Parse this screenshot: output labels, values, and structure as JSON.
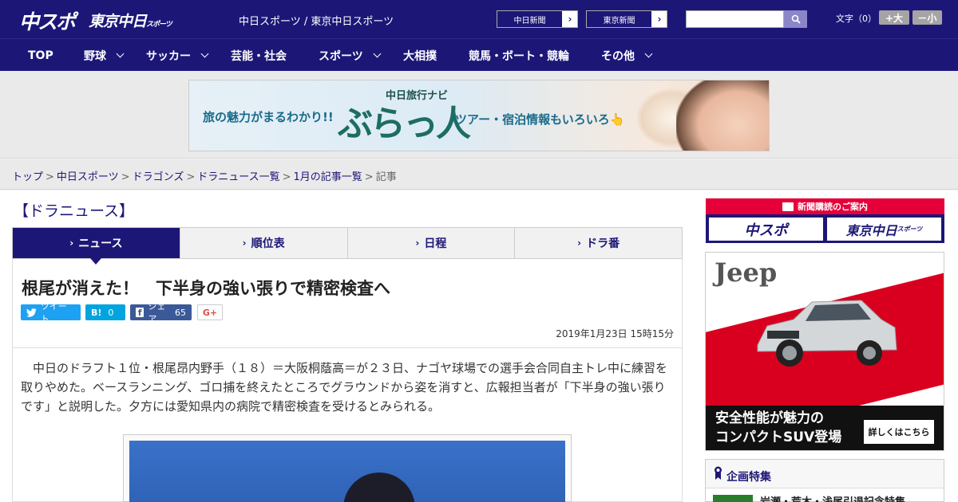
{
  "header": {
    "logo_chuspo": "中スポ",
    "logo_tokyo": "東京中日",
    "logo_tokyo_small": "スポーツ",
    "site_links": "中日スポーツ / 東京中日スポーツ",
    "ext_links": [
      {
        "label": "中日新聞",
        "arrow": "›"
      },
      {
        "label": "東京新聞",
        "arrow": "›"
      }
    ],
    "search_placeholder": "",
    "search_icon": "search-icon",
    "font_size_label": "文字（0）",
    "font_up": "+大",
    "font_down": "－小"
  },
  "nav": {
    "items": [
      {
        "label": "TOP",
        "dropdown": false
      },
      {
        "label": "野球",
        "dropdown": true
      },
      {
        "label": "サッカー",
        "dropdown": true
      },
      {
        "label": "芸能・社会",
        "dropdown": false
      },
      {
        "label": "スポーツ",
        "dropdown": true
      },
      {
        "label": "大相撲",
        "dropdown": false
      },
      {
        "label": "競馬・ボート・競輪",
        "dropdown": false
      },
      {
        "label": "その他",
        "dropdown": true
      }
    ]
  },
  "banner": {
    "left_text": "旅の魅力がまるわかり!!",
    "navi_label": "中日旅行ナビ",
    "brand": "ぶらっ人",
    "right_text": "ツアー・宿泊情報もいろいろ👆"
  },
  "breadcrumb": {
    "items": [
      "トップ",
      "中日スポーツ",
      "ドラゴンズ",
      "ドラニュース一覧",
      "1月の記事一覧"
    ],
    "separator": ">",
    "current": "記事"
  },
  "section": {
    "title": "【ドラニュース】",
    "tabs": [
      {
        "label": "ニュース",
        "active": true
      },
      {
        "label": "順位表",
        "active": false
      },
      {
        "label": "日程",
        "active": false
      },
      {
        "label": "ドラ番",
        "active": false
      }
    ],
    "tab_caret": "›"
  },
  "article": {
    "headline": "根尾が消えた！　下半身の強い張りで精密検査へ",
    "share": {
      "tweet": "ツイート",
      "hatena_label": "B!",
      "hatena_count": "0",
      "fb_label": "シェア",
      "fb_count": "65",
      "gplus": "G+"
    },
    "date": "2019年1月23日 15時15分",
    "body": "中日のドラフト１位・根尾昂内野手（１８）＝大阪桐蔭高＝が２３日、ナゴヤ球場での選手会合同自主トレ中に練習を取りやめた。ベースランニング、ゴロ捕を終えたところでグラウンドから姿を消すと、広報担当者が「下半身の強い張りです」と説明した。夕方には愛知県内の病院で精密検査を受けるとみられる。"
  },
  "sidebar": {
    "subscribe_head": "新聞購読のご案内",
    "subscribe_btn1": "中スポ",
    "subscribe_btn2": "東京中日",
    "subscribe_btn2_small": "スポーツ",
    "ad": {
      "brand": "Jeep",
      "copy_line1": "安全性能が魅力の",
      "copy_line2": "コンパクトSUV登場",
      "cta": "詳しくはこちら"
    },
    "feature": {
      "title": "企画特集",
      "item": "岩瀬・荒木・浅尾引退記念特集"
    }
  },
  "colors": {
    "brand_navy": "#1c1777",
    "accent_red": "#e60039",
    "twitter": "#1da1f2",
    "hatena": "#00a4de",
    "facebook": "#3b5998"
  }
}
